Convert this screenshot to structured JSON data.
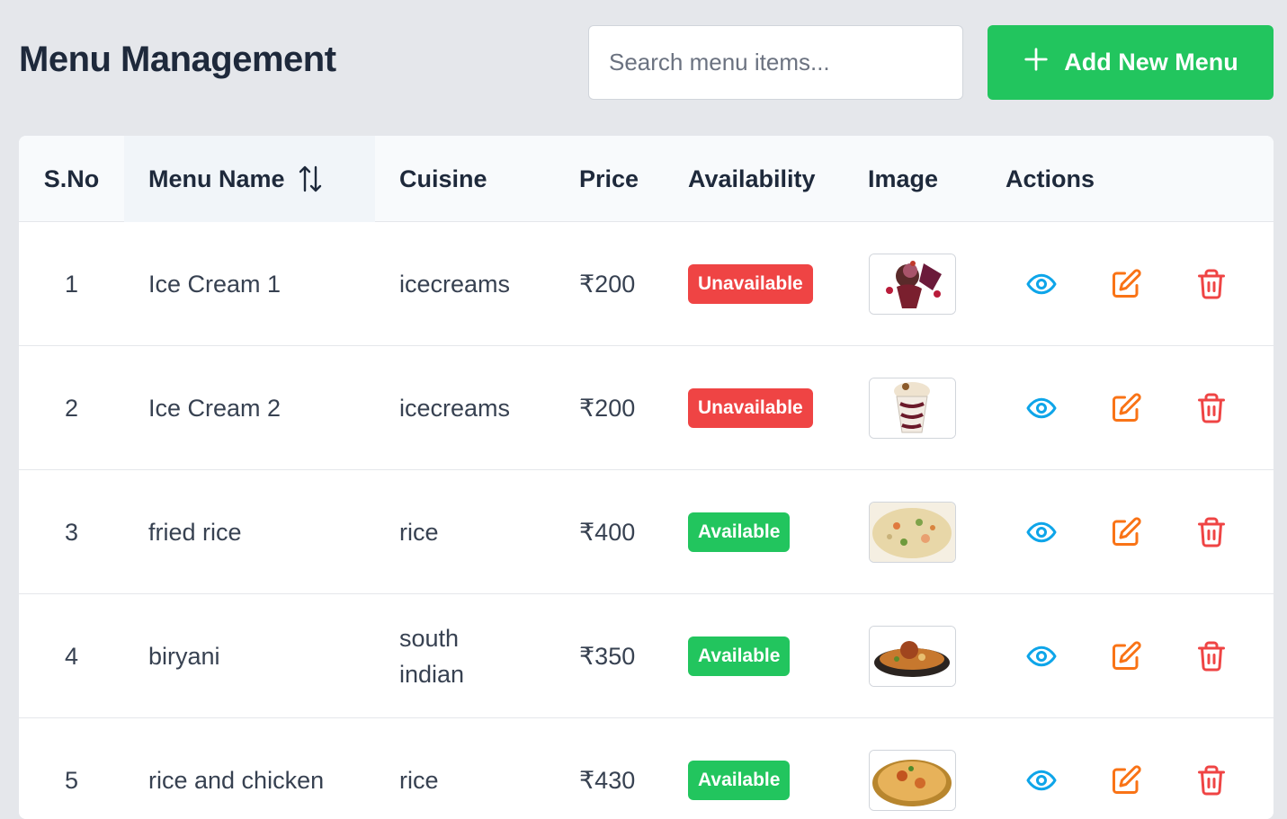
{
  "header": {
    "title": "Menu Management",
    "search_placeholder": "Search menu items...",
    "search_value": "",
    "add_button_label": "Add New Menu"
  },
  "table": {
    "columns": [
      "S.No",
      "Menu Name",
      "Cuisine",
      "Price",
      "Availability",
      "Image",
      "Actions"
    ],
    "rows": [
      {
        "sno": "1",
        "name": "Ice Cream 1",
        "cuisine": "icecreams",
        "price": "₹200",
        "availability": "Unavailable",
        "image": "ice-cream-1-thumbnail"
      },
      {
        "sno": "2",
        "name": "Ice Cream 2",
        "cuisine": "icecreams",
        "price": "₹200",
        "availability": "Unavailable",
        "image": "ice-cream-2-thumbnail"
      },
      {
        "sno": "3",
        "name": "fried rice",
        "cuisine": "rice",
        "price": "₹400",
        "availability": "Available",
        "image": "fried-rice-thumbnail"
      },
      {
        "sno": "4",
        "name": "biryani",
        "cuisine": "south indian",
        "price": "₹350",
        "availability": "Available",
        "image": "biryani-thumbnail"
      },
      {
        "sno": "5",
        "name": "rice and chicken",
        "cuisine": "rice",
        "price": "₹430",
        "availability": "Available",
        "image": "rice-and-chicken-thumbnail"
      }
    ]
  },
  "icons": {
    "sort": "sort-arrows-icon",
    "add": "plus-icon",
    "view": "eye-icon",
    "edit": "edit-icon",
    "delete": "trash-icon"
  },
  "colors": {
    "background": "#e5e7eb",
    "primary_green": "#22c55e",
    "unavailable_red": "#ef4444",
    "view_blue": "#0ea5e9",
    "edit_orange": "#f97316",
    "delete_red": "#ef4444"
  }
}
